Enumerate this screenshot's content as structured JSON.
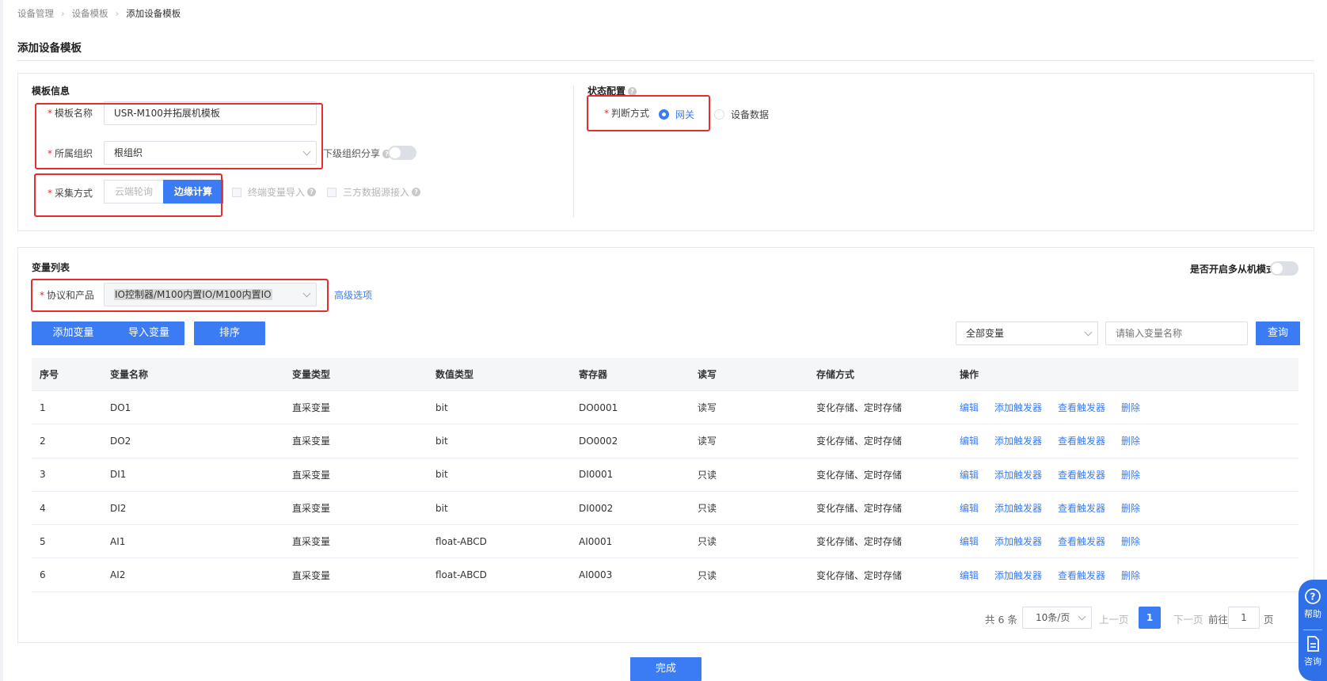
{
  "breadcrumb": [
    "设备管理",
    "设备模板",
    "添加设备模板"
  ],
  "page_title": "添加设备模板",
  "template_info": {
    "section_title": "模板信息",
    "name_label": "模板名称",
    "name_value": "USR-M100并拓展机模板",
    "org_label": "所属组织",
    "org_value": "根组织",
    "share_label": "下级组织分享",
    "collect_label": "采集方式",
    "collect_options": [
      "云端轮询",
      "边缘计算"
    ],
    "checkbox1": "终端变量导入",
    "checkbox2": "三方数据源接入"
  },
  "status_config": {
    "section_title": "状态配置",
    "judge_label": "判断方式",
    "options": [
      "网关",
      "设备数据"
    ]
  },
  "variable_list": {
    "section_title": "变量列表",
    "multi_slave_label": "是否开启多从机模式",
    "protocol_label": "协议和产品",
    "protocol_value": "IO控制器/M100内置IO/M100内置IO",
    "advanced_link": "高级选项",
    "buttons": [
      "添加变量",
      "导入变量",
      "排序"
    ],
    "filter_value": "全部变量",
    "search_placeholder": "请输入变量名称",
    "search_button": "查询"
  },
  "table": {
    "headers": [
      "序号",
      "变量名称",
      "变量类型",
      "数值类型",
      "寄存器",
      "读写",
      "存储方式",
      "操作"
    ],
    "rows": [
      [
        "1",
        "DO1",
        "直采变量",
        "bit",
        "DO0001",
        "读写",
        "变化存储、定时存储"
      ],
      [
        "2",
        "DO2",
        "直采变量",
        "bit",
        "DO0002",
        "读写",
        "变化存储、定时存储"
      ],
      [
        "3",
        "DI1",
        "直采变量",
        "bit",
        "DI0001",
        "只读",
        "变化存储、定时存储"
      ],
      [
        "4",
        "DI2",
        "直采变量",
        "bit",
        "DI0002",
        "只读",
        "变化存储、定时存储"
      ],
      [
        "5",
        "AI1",
        "直采变量",
        "float-ABCD",
        "AI0001",
        "只读",
        "变化存储、定时存储"
      ],
      [
        "6",
        "AI2",
        "直采变量",
        "float-ABCD",
        "AI0003",
        "只读",
        "变化存储、定时存储"
      ]
    ],
    "ops": [
      "编辑",
      "添加触发器",
      "查看触发器",
      "删除"
    ]
  },
  "pagination": {
    "total": "共 6 条",
    "page_size": "10条/页",
    "prev": "上一页",
    "current": "1",
    "next": "下一页",
    "goto": "前往",
    "goto_value": "1",
    "page_unit": "页"
  },
  "finish_button": "完成",
  "side": {
    "help": "帮助",
    "consult": "咨询"
  },
  "colors": {
    "primary": "#3b7cf5",
    "annotation": "#e62e2e"
  }
}
